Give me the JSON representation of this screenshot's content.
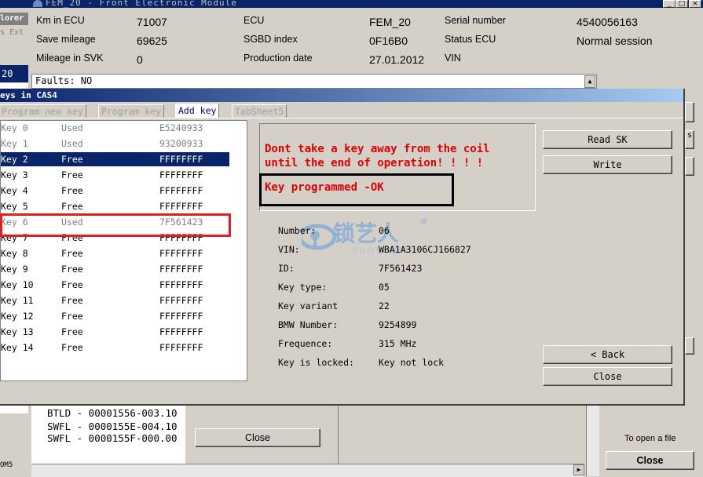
{
  "window": {
    "title": "FEM_20 - Front Electronic Module",
    "left_labels": [
      "lorer",
      "s",
      "Ext",
      "20",
      "OM5"
    ]
  },
  "info": {
    "km_in_ecu_label": "Km in ECU",
    "km_in_ecu_value": "71007",
    "save_mileage_label": "Save mileage",
    "save_mileage_value": "69625",
    "mileage_svk_label": "Mileage in SVK",
    "mileage_svk_value": "0",
    "ecu_label": "ECU",
    "ecu_value": "FEM_20",
    "sgbd_label": "SGBD index",
    "sgbd_value": "0F16B0",
    "prod_date_label": "Production date",
    "prod_date_value": "27.01.2012",
    "serial_label": "Serial number",
    "serial_value": "4540056163",
    "status_label": "Status ECU",
    "status_value": "Normal session",
    "vin_label": "VIN",
    "faults": "Faults: NO"
  },
  "dialog": {
    "title": "eys in CAS4",
    "tabs": [
      "Program new key",
      "Program key",
      "Add key",
      "TabSheet5"
    ],
    "active_tab": "Add key",
    "keys": [
      {
        "name": "Key 0",
        "status": "Used",
        "id": "E5240933"
      },
      {
        "name": "Key 1",
        "status": "Used",
        "id": "93200933"
      },
      {
        "name": "Key 2",
        "status": "Free",
        "id": "FFFFFFFF"
      },
      {
        "name": "Key 3",
        "status": "Free",
        "id": "FFFFFFFF"
      },
      {
        "name": "Key 4",
        "status": "Free",
        "id": "FFFFFFFF"
      },
      {
        "name": "Key 5",
        "status": "Free",
        "id": "FFFFFFFF"
      },
      {
        "name": "Key 6",
        "status": "Used",
        "id": "7F561423"
      },
      {
        "name": "Key 7",
        "status": "Free",
        "id": "FFFFFFFF"
      },
      {
        "name": "Key 8",
        "status": "Free",
        "id": "FFFFFFFF"
      },
      {
        "name": "Key 9",
        "status": "Free",
        "id": "FFFFFFFF"
      },
      {
        "name": "Key 10",
        "status": "Free",
        "id": "FFFFFFFF"
      },
      {
        "name": "Key 11",
        "status": "Free",
        "id": "FFFFFFFF"
      },
      {
        "name": "Key 12",
        "status": "Free",
        "id": "FFFFFFFF"
      },
      {
        "name": "Key 13",
        "status": "Free",
        "id": "FFFFFFFF"
      },
      {
        "name": "Key 14",
        "status": "Free",
        "id": "FFFFFFFF"
      }
    ],
    "selected_key": "Key 2",
    "warning_line1": "Dont take a key away from the coil",
    "warning_line2": "until the end of operation! ! ! !",
    "result": "Key programmed -OK",
    "details": [
      {
        "label": "Number:",
        "value": "06"
      },
      {
        "label": "VIN:",
        "value": "WBA1A3106CJ166827"
      },
      {
        "label": "ID:",
        "value": "7F561423"
      },
      {
        "label": "Key type:",
        "value": "05"
      },
      {
        "label": "Key variant",
        "value": "22"
      },
      {
        "label": "BMW Number:",
        "value": "9254899"
      },
      {
        "label": "Frequence:",
        "value": "315 MHz"
      },
      {
        "label": "Key is locked:",
        "value": "Key not lock"
      }
    ],
    "read_sk_label": "Read SK",
    "write_label": "Write",
    "back_label": "< Back",
    "close_label": "Close"
  },
  "watermark": {
    "cn": "锁艺人",
    "en": "SUOYIREN",
    "reg": "®"
  },
  "bottom": {
    "lines": [
      "BTLD - 00001556-003.10",
      "SWFL - 0000155E-004.10",
      "SWFL - 0000155F-000.00"
    ],
    "close_label": "Close",
    "open_file_text": "To open a file",
    "close_right_label": "Close",
    "colors": {
      "accent": "#0a246a",
      "warning": "#e00000",
      "highlight_box": "#e02020"
    }
  }
}
